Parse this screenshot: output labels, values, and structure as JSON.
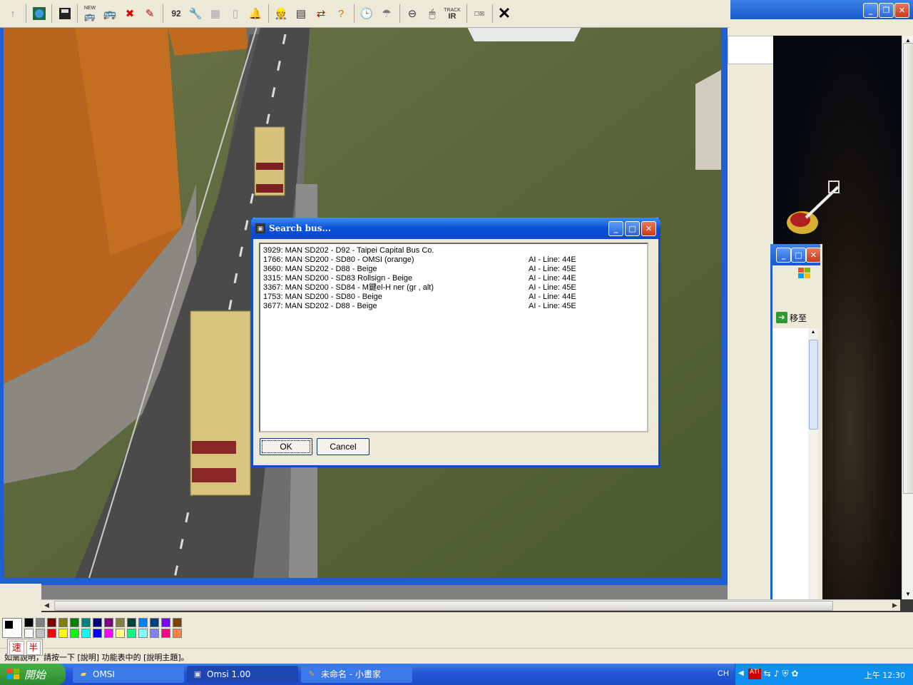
{
  "paint": {
    "status_text": "如需說明，請按一下 [說明] 功能表中的 [說明主題]。",
    "ime_speed": "速",
    "ime_half": "半",
    "go_label": "移至",
    "palette": [
      "#000000",
      "#808080",
      "#800000",
      "#808000",
      "#008000",
      "#008080",
      "#000080",
      "#800080",
      "#808040",
      "#004040",
      "#0080ff",
      "#004080",
      "#8000ff",
      "#804000",
      "#ffffff",
      "#c0c0c0",
      "#ff0000",
      "#ffff00",
      "#00ff00",
      "#00ffff",
      "#0000ff",
      "#ff00ff",
      "#ffff80",
      "#00ff80",
      "#80ffff",
      "#8080ff",
      "#ff0080",
      "#ff8040"
    ]
  },
  "toolbar": {
    "items": [
      "up-arrow",
      "map",
      "save",
      "new-bus",
      "bus",
      "delete-bus",
      "pen",
      "number",
      "wrench",
      "block",
      "cylinder",
      "bell",
      "driver",
      "timetable",
      "swap",
      "help-arrow",
      "clock",
      "weather",
      "steering",
      "mouse",
      "trackir",
      "gear-mode",
      "close"
    ],
    "new_label": "NEW",
    "track_label": "TRACK",
    "ir_label": "IR"
  },
  "dialog": {
    "title": "Search bus...",
    "rows": [
      {
        "name": "3929: MAN SD202 - D92 - Taipei Capital Bus Co.",
        "ai": ""
      },
      {
        "name": "1766: MAN SD200 - SD80 - OMSI (orange)",
        "ai": "AI - Line: 44E"
      },
      {
        "name": "3660: MAN SD202 - D88 - Beige",
        "ai": "AI - Line: 45E"
      },
      {
        "name": "3315: MAN SD200 - SD83 Rollsign - Beige",
        "ai": "AI - Line: 44E"
      },
      {
        "name": "3367: MAN SD200 - SD84 - M鍵el-H     ner (gr     , alt)",
        "ai": "AI - Line: 45E"
      },
      {
        "name": "1753: MAN SD200 - SD80 - Beige",
        "ai": "AI - Line: 44E"
      },
      {
        "name": "3677: MAN SD202 - D88 - Beige",
        "ai": "AI - Line: 45E"
      }
    ],
    "ok_label": "OK",
    "cancel_label": "Cancel"
  },
  "taskbar": {
    "start_label": "開始",
    "tasks": [
      {
        "label": "OMSI",
        "icon": "folder-icon"
      },
      {
        "label": "Omsi 1.00",
        "icon": "bus-icon"
      },
      {
        "label": "未命名 - 小畫家",
        "icon": "paint-icon"
      }
    ],
    "lang": "CH",
    "clock": "上午 12:30"
  }
}
